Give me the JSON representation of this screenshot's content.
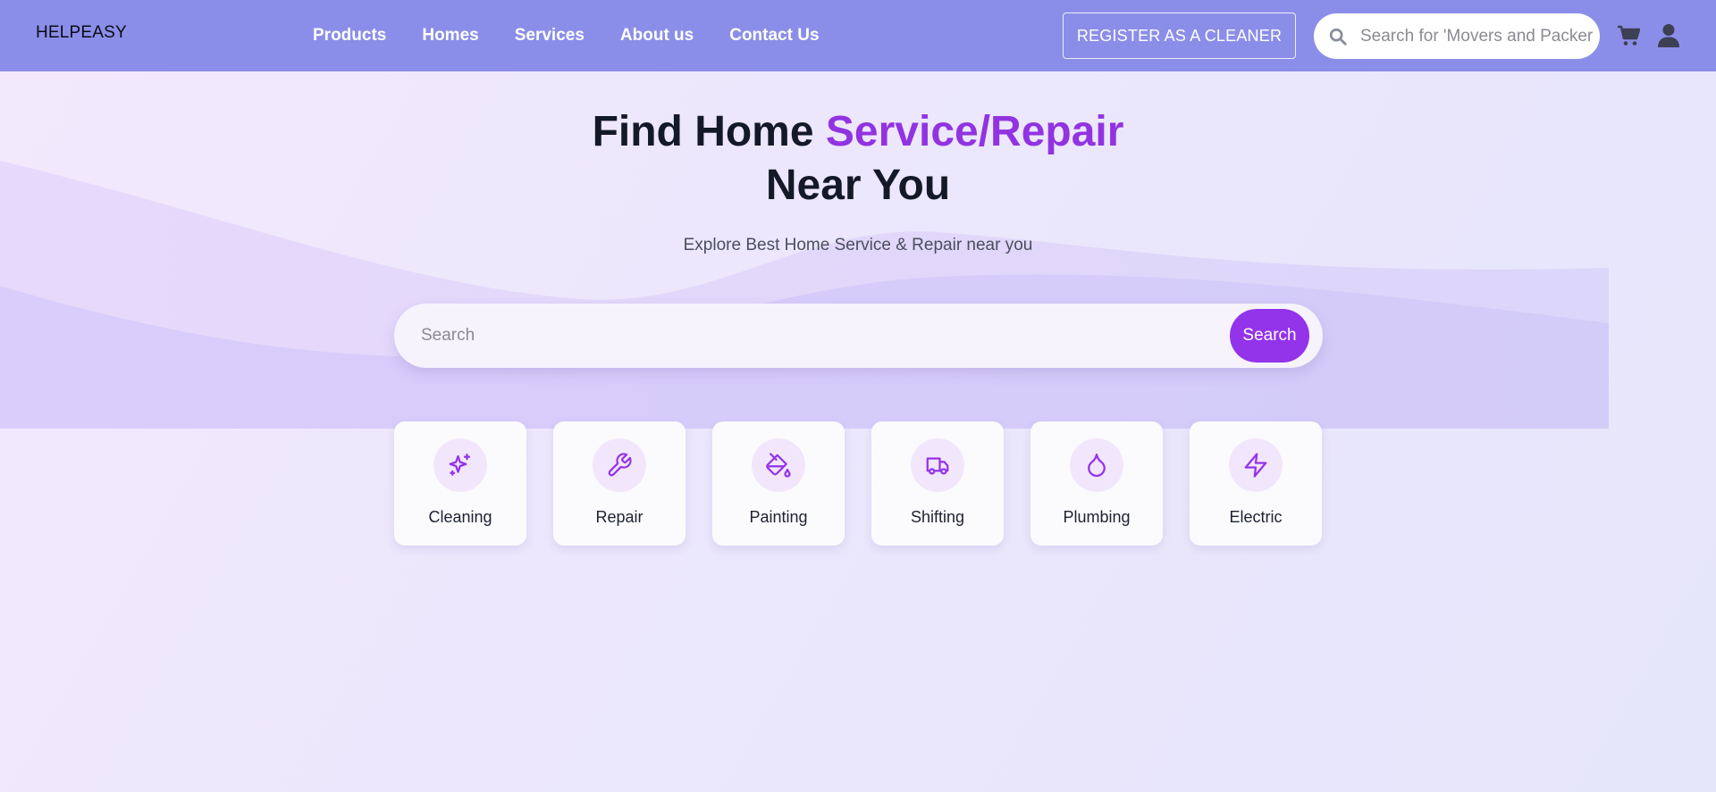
{
  "colors": {
    "navbar_bg": "#8b8ee8",
    "accent": "#9333ea",
    "title_dark": "#141927",
    "icon_circle": "#f2e6fc"
  },
  "navbar": {
    "brand": "HELPEASY",
    "links": [
      {
        "label": "Products"
      },
      {
        "label": "Homes"
      },
      {
        "label": "Services"
      },
      {
        "label": "About us"
      },
      {
        "label": "Contact Us"
      }
    ],
    "register_label": "REGISTER AS A CLEANER",
    "search_placeholder": "Search for 'Movers and Packers'",
    "search_icon": "search-icon",
    "cart_icon": "cart-icon",
    "user_icon": "user-icon"
  },
  "hero": {
    "title_part1": "Find Home ",
    "title_accent": "Service/Repair",
    "title_part2": "Near You",
    "subtitle": "Explore Best Home Service & Repair near you",
    "search_placeholder": "Search",
    "search_button": "Search"
  },
  "categories": [
    {
      "label": "Cleaning",
      "icon": "sparkles-icon"
    },
    {
      "label": "Repair",
      "icon": "wrench-icon"
    },
    {
      "label": "Painting",
      "icon": "paint-bucket-icon"
    },
    {
      "label": "Shifting",
      "icon": "truck-icon"
    },
    {
      "label": "Plumbing",
      "icon": "droplet-icon"
    },
    {
      "label": "Electric",
      "icon": "lightning-icon"
    }
  ]
}
